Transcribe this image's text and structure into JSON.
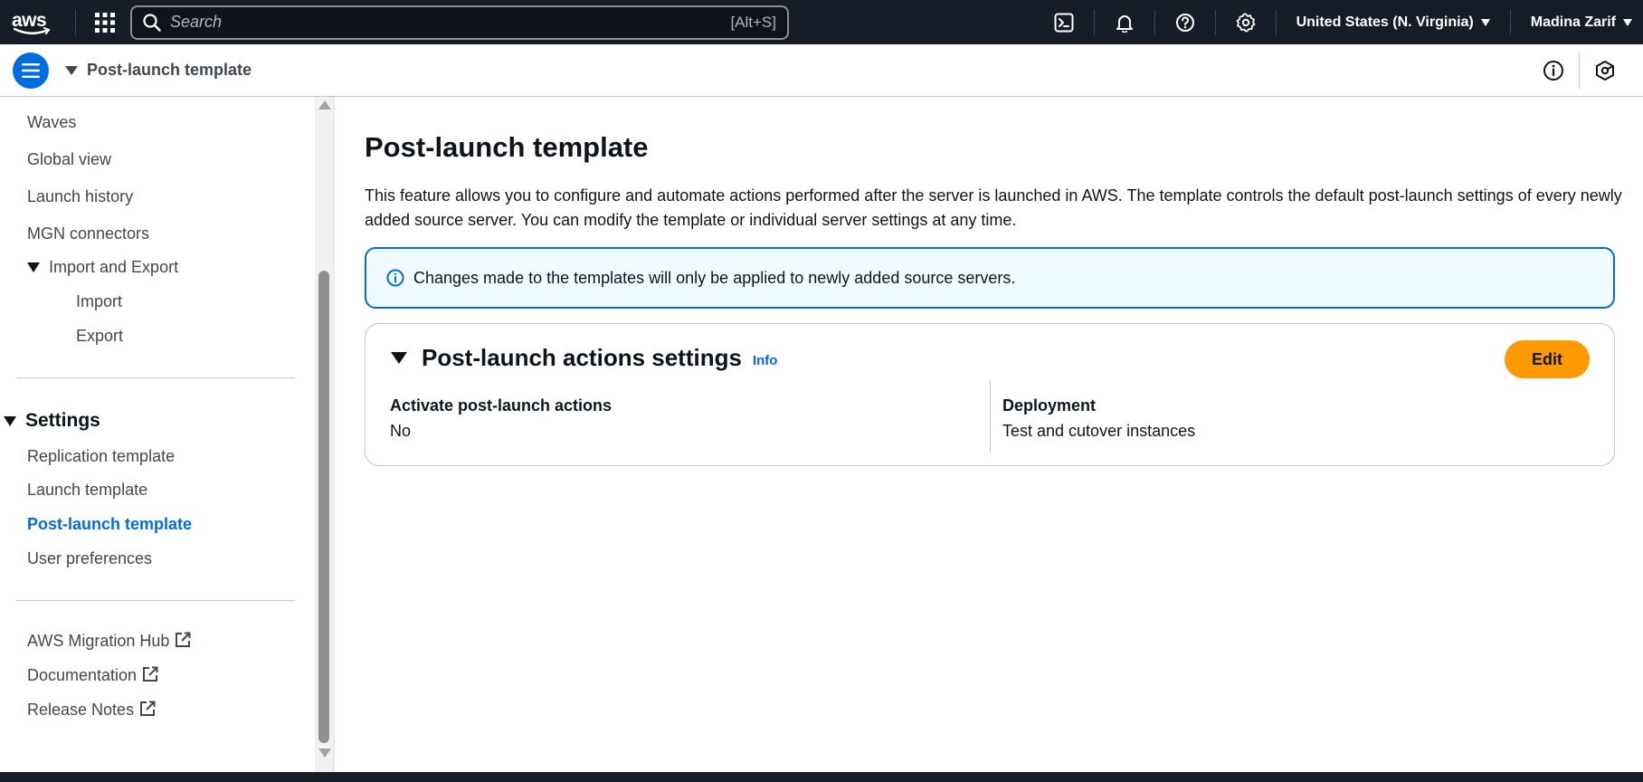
{
  "topnav": {
    "logo_text": "aws",
    "search": {
      "placeholder": "Search",
      "shortcut": "[Alt+S]"
    },
    "icons": [
      "cloudshell-icon",
      "bell-icon",
      "help-icon",
      "gear-icon"
    ],
    "region": "United States (N. Virginia)",
    "user": "Madina Zarif"
  },
  "breadcrumb": {
    "label": "Post-launch template"
  },
  "sidenav": {
    "items_top": [
      {
        "label": "Waves"
      },
      {
        "label": "Global view"
      },
      {
        "label": "Launch history"
      },
      {
        "label": "MGN connectors"
      }
    ],
    "import_export": {
      "label": "Import and Export",
      "children": [
        {
          "label": "Import"
        },
        {
          "label": "Export"
        }
      ]
    },
    "settings": {
      "label": "Settings",
      "items": [
        {
          "label": "Replication template"
        },
        {
          "label": "Launch template"
        },
        {
          "label": "Post-launch template",
          "active": true
        },
        {
          "label": "User preferences"
        }
      ]
    },
    "external_links": [
      {
        "label": "AWS Migration Hub"
      },
      {
        "label": "Documentation"
      },
      {
        "label": "Release Notes"
      }
    ]
  },
  "main": {
    "title": "Post-launch template",
    "description": "This feature allows you to configure and automate actions performed after the server is launched in AWS. The template controls the default post-launch settings of every newly added source server. You can modify the template or individual server settings at any time.",
    "alert": "Changes made to the templates will only be applied to newly added source servers.",
    "card": {
      "title": "Post-launch actions settings",
      "info": "Info",
      "edit_label": "Edit",
      "fields": [
        {
          "label": "Activate post-launch actions",
          "value": "No"
        },
        {
          "label": "Deployment",
          "value": "Test and cutover instances"
        }
      ]
    }
  },
  "colors": {
    "nav_bg": "#161d26",
    "accent_blue": "#006ce0",
    "primary_button": "#ff9900",
    "alert_bg": "#f0fbff"
  }
}
